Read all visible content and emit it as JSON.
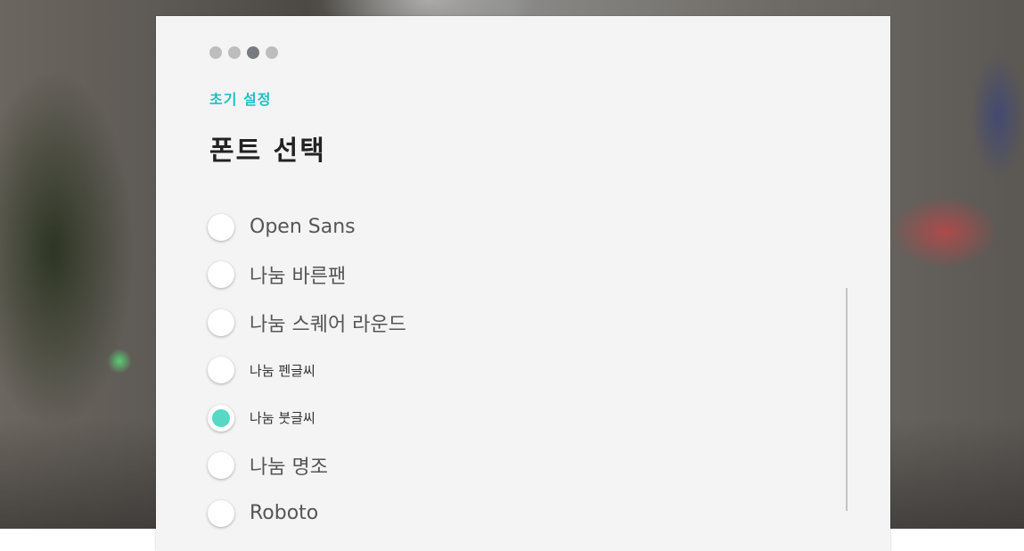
{
  "wizard": {
    "step_count": 4,
    "active_step": 3,
    "subtitle": "초기 설정",
    "title": "폰트 선택"
  },
  "fonts": {
    "selected": "나눔 붓글씨",
    "options": [
      {
        "label": "Open Sans",
        "checked": false
      },
      {
        "label": "나눔 바른팬",
        "checked": false
      },
      {
        "label": "나눔 스퀘어 라운드",
        "checked": false
      },
      {
        "label": "나눔 펜글씨",
        "checked": false
      },
      {
        "label": "나눔 붓글씨",
        "checked": true
      },
      {
        "label": "나눔 명조",
        "checked": false
      },
      {
        "label": "Roboto",
        "checked": false
      }
    ]
  },
  "colors": {
    "accent": "#1fbfc2",
    "radio_checked": "#56d8c4",
    "step_active": "#777b80",
    "step_inactive": "#bdbdbd"
  }
}
